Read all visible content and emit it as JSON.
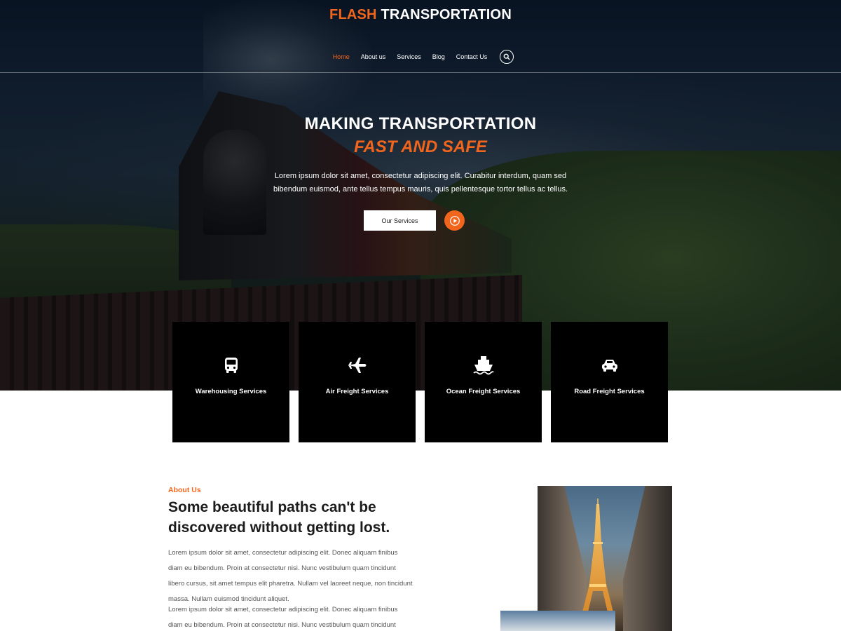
{
  "header": {
    "brand_accent": "FLASH",
    "brand_main": "TRANSPORTATION",
    "nav": [
      {
        "label": "Home",
        "active": true
      },
      {
        "label": "About us"
      },
      {
        "label": "Services"
      },
      {
        "label": "Blog"
      },
      {
        "label": "Contact Us"
      }
    ],
    "search_icon": "search-icon"
  },
  "hero": {
    "title": "MAKING TRANSPORTATION",
    "subtitle": "FAST AND SAFE",
    "text": "Lorem ipsum dolor sit amet, consectetur adipiscing elit. Curabitur interdum, quam sed bibendum euismod, ante tellus tempus mauris, quis pellentesque tortor tellus ac tellus.",
    "button_label": "Our Services",
    "play_icon": "play-icon"
  },
  "services": [
    {
      "title": "Warehousing Services",
      "icon": "bus-icon"
    },
    {
      "title": "Air Freight Services",
      "icon": "airplane-icon"
    },
    {
      "title": "Ocean Freight Services",
      "icon": "ship-icon"
    },
    {
      "title": "Road Freight Services",
      "icon": "car-icon"
    }
  ],
  "about": {
    "label": "About Us",
    "heading": "Some beautiful paths can't be discovered without getting lost.",
    "paragraph_1": "Lorem ipsum dolor sit amet, consectetur adipiscing elit. Donec aliquam finibus diam eu bibendum. Proin at consectetur nisi. Nunc vestibulum quam tincidunt libero cursus, sit amet tempus elit pharetra. Nullam vel laoreet neque, non tincidunt massa. Nullam euismod tincidunt aliquet.",
    "paragraph_2": "Lorem ipsum dolor sit amet, consectetur adipiscing elit. Donec aliquam finibus diam eu bibendum. Proin at consectetur nisi. Nunc vestibulum quam tincidunt"
  },
  "colors": {
    "accent": "#f2651d",
    "card_bg": "#000000",
    "text_dark": "#1c1c1c"
  }
}
